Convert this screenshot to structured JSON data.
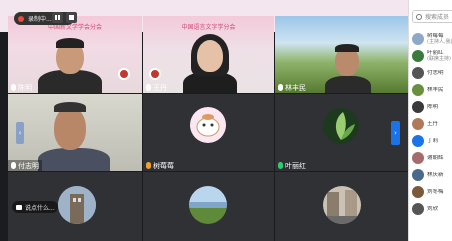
{
  "recording": {
    "label": "录制中..."
  },
  "tiles": {
    "t1": {
      "banner": "中国新文学学会分会",
      "name": "陈明"
    },
    "t2": {
      "banner": "中国语言文字学分会",
      "name": "王丹"
    },
    "t3": {
      "name": "林丰民"
    },
    "t4": {
      "name": "付志明"
    },
    "t5": {
      "name": "树莓莓"
    },
    "t6": {
      "name": "叶丽红"
    }
  },
  "chat_toast": {
    "text": "说点什么..."
  },
  "panel": {
    "search_placeholder": "搜索成员",
    "participants": [
      {
        "name": "树莓莓",
        "sub": "(主持人,我)",
        "color": "#8fa7c9"
      },
      {
        "name": "叶丽红",
        "sub": "(联席主持)",
        "color": "#3c7a3c"
      },
      {
        "name": "付志明",
        "sub": "",
        "color": "#555"
      },
      {
        "name": "林丰民",
        "sub": "",
        "color": "#6a8f3f"
      },
      {
        "name": "陈明",
        "sub": "",
        "color": "#3a3a3a"
      },
      {
        "name": "王丹",
        "sub": "",
        "color": "#b07a5a"
      },
      {
        "name": "丁莉",
        "sub": "",
        "color": "#1a73e8"
      },
      {
        "name": "谢朝辉",
        "sub": "",
        "color": "#a56a6a"
      },
      {
        "name": "林庆新",
        "sub": "",
        "color": "#4a6a8a"
      },
      {
        "name": "刘冬梅",
        "sub": "",
        "color": "#7a5a3a"
      },
      {
        "name": "刘欣",
        "sub": "",
        "color": "#555"
      }
    ]
  }
}
